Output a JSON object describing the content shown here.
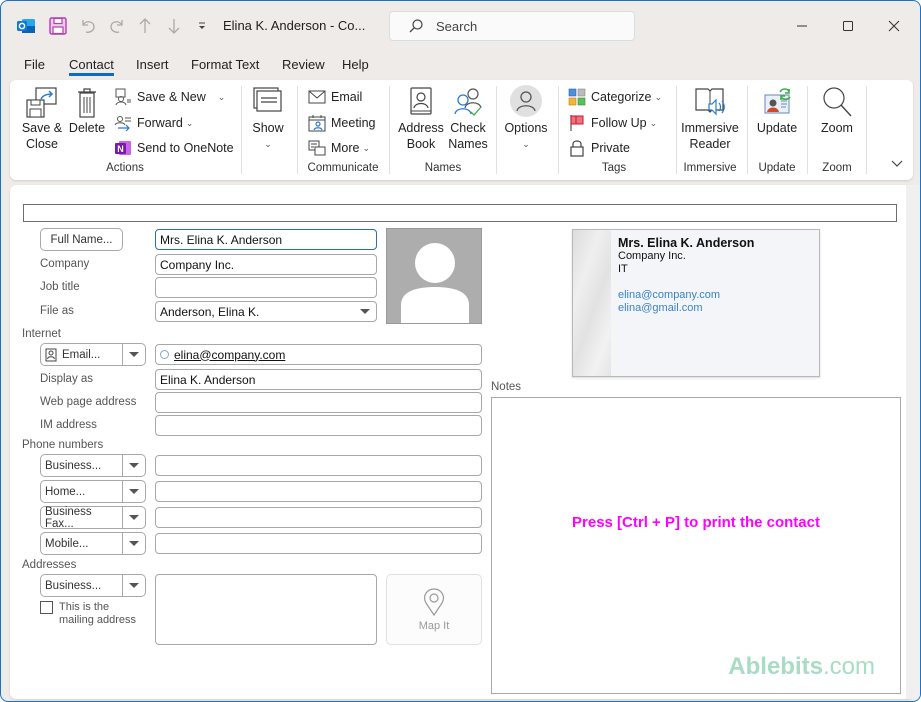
{
  "titlebar": {
    "title": "Elina K. Anderson  -  Co...",
    "search_placeholder": "Search"
  },
  "menu_tabs": [
    {
      "label": "File",
      "active": false
    },
    {
      "label": "Contact",
      "active": true
    },
    {
      "label": "Insert",
      "active": false
    },
    {
      "label": "Format Text",
      "active": false
    },
    {
      "label": "Review",
      "active": false
    },
    {
      "label": "Help",
      "active": false
    }
  ],
  "ribbon": {
    "actions": {
      "save_close_1": "Save &",
      "save_close_2": "Close",
      "delete": "Delete",
      "save_new": "Save & New",
      "forward": "Forward",
      "send_onenote": "Send to OneNote",
      "group_label": "Actions"
    },
    "show": {
      "label": "Show"
    },
    "communicate": {
      "email": "Email",
      "meeting": "Meeting",
      "more": "More",
      "group_label": "Communicate"
    },
    "names": {
      "address_book_1": "Address",
      "address_book_2": "Book",
      "check_names_1": "Check",
      "check_names_2": "Names",
      "group_label": "Names"
    },
    "options": {
      "label": "Options"
    },
    "tags": {
      "categorize": "Categorize",
      "follow_up": "Follow Up",
      "private": "Private",
      "group_label": "Tags"
    },
    "immersive": {
      "reader_1": "Immersive",
      "reader_2": "Reader",
      "group_label": "Immersive"
    },
    "update": {
      "label": "Update",
      "group_label": "Update"
    },
    "zoom": {
      "label": "Zoom",
      "group_label": "Zoom"
    }
  },
  "form": {
    "full_name_button": "Full Name...",
    "full_name_value": "Mrs. Elina K. Anderson",
    "company_label": "Company",
    "company_value": "Company Inc.",
    "job_title_label": "Job title",
    "job_title_value": "",
    "file_as_label": "File as",
    "file_as_value": "Anderson, Elina K.",
    "internet_section": "Internet",
    "email_button": "Email...",
    "email_value": "elina@company.com",
    "display_as_label": "Display as",
    "display_as_value": "Elina K. Anderson",
    "web_page_label": "Web page address",
    "web_page_value": "",
    "im_label": "IM address",
    "im_value": "",
    "phone_section": "Phone numbers",
    "phones": [
      {
        "type": "Business...",
        "value": ""
      },
      {
        "type": "Home...",
        "value": ""
      },
      {
        "type": "Business Fax...",
        "value": ""
      },
      {
        "type": "Mobile...",
        "value": ""
      }
    ],
    "addresses_section": "Addresses",
    "address_type": "Business...",
    "address_value": "",
    "mailing_checkbox_1": "This is the",
    "mailing_checkbox_2": "mailing address",
    "mailing_checked": false,
    "map_it": "Map It",
    "notes_label": "Notes",
    "notes_value": ""
  },
  "business_card": {
    "name": "Mrs. Elina K. Anderson",
    "company": "Company Inc.",
    "department": "IT",
    "email1": "elina@company.com",
    "email2": "elina@gmail.com"
  },
  "overlay": {
    "print_hint": "Press [Ctrl + P] to print the contact",
    "watermark_brand": "Ablebits",
    "watermark_domain": ".com",
    "hint_color": "#ff00ff"
  }
}
